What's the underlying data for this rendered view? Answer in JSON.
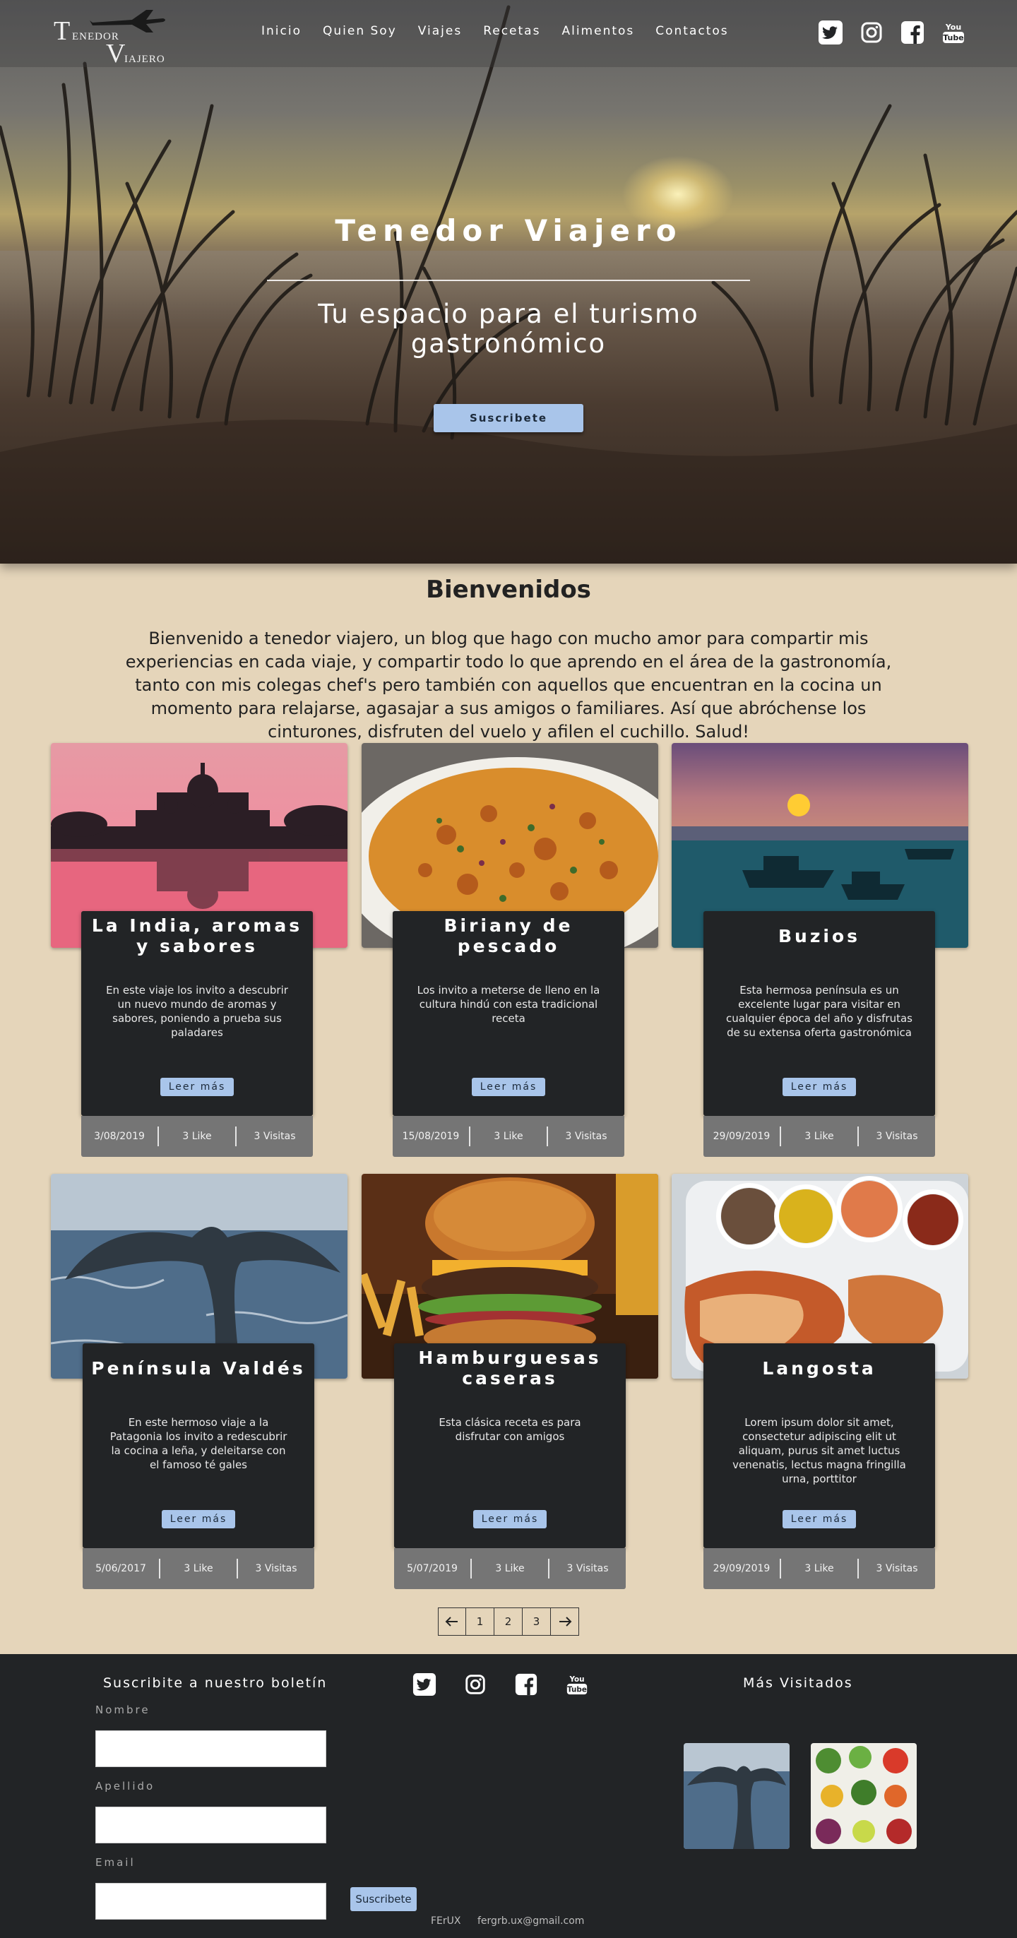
{
  "logo": {
    "t_big": "T",
    "t_small": "ENEDOR",
    "v_big": "V",
    "v_small": "IAJERO"
  },
  "nav": {
    "items": [
      "Inicio",
      "Quien Soy",
      "Viajes",
      "Recetas",
      "Alimentos",
      "Contactos"
    ]
  },
  "social_icons": [
    "twitter-icon",
    "instagram-icon",
    "facebook-icon",
    "youtube-icon"
  ],
  "hero": {
    "title": "Tenedor Viajero",
    "subtitle": "Tu espacio para el turismo gastronómico",
    "subscribe_label": "Suscribete"
  },
  "welcome": {
    "title": "Bienvenidos",
    "text": "Bienvenido a tenedor viajero, un blog que hago con mucho amor para compartir mis experiencias en cada viaje, y compartir todo lo que aprendo en el área de la gastronomía, tanto con mis colegas chef's pero también con aquellos que encuentran en la cocina un momento para relajarse, agasajar a sus amigos o familiares. Así que abróchense los cinturones, disfruten del vuelo y afilen el cuchillo. Salud!"
  },
  "cards": [
    {
      "title": "La India, aromas y sabores",
      "desc": "En este viaje los invito a descubrir un nuevo mundo de aromas y sabores, poniendo a prueba sus paladares",
      "button": "Leer más",
      "date": "3/08/2019",
      "likes": "3 Like",
      "visits": "3 Visitas"
    },
    {
      "title": "Biriany de pescado",
      "desc": "Los invito a meterse de lleno en la cultura hindú con esta tradicional receta",
      "button": "Leer más",
      "date": "15/08/2019",
      "likes": "3 Like",
      "visits": "3 Visitas"
    },
    {
      "title": "Buzios",
      "desc": "Esta hermosa península es un excelente lugar para visitar en cualquier época del año y disfrutas de su extensa oferta gastronómica",
      "button": "Leer más",
      "date": "29/09/2019",
      "likes": "3 Like",
      "visits": "3 Visitas"
    },
    {
      "title": "Península Valdés",
      "desc": "En este hermoso viaje a la Patagonia los invito a redescubrir la cocina a leña, y deleitarse con el famoso té gales",
      "button": "Leer más",
      "date": "5/06/2017",
      "likes": "3 Like",
      "visits": "3 Visitas"
    },
    {
      "title": "Hamburguesas caseras",
      "desc": "Esta clásica receta es para disfrutar con amigos",
      "button": "Leer más",
      "date": "5/07/2019",
      "likes": "3 Like",
      "visits": "3 Visitas"
    },
    {
      "title": "Langosta",
      "desc": "Lorem ipsum dolor sit amet, consectetur adipiscing elit ut aliquam, purus sit amet luctus venenatis, lectus magna fringilla urna, porttitor",
      "button": "Leer más",
      "date": "29/09/2019",
      "likes": "3 Like",
      "visits": "3 Visitas"
    }
  ],
  "pagination": {
    "prev_icon": "arrow-left-icon",
    "pages": [
      "1",
      "2",
      "3"
    ],
    "next_icon": "arrow-right-icon"
  },
  "footer": {
    "newsletter_title": "Suscribite a nuestro boletín",
    "name_label": "Nombre",
    "surname_label": "Apellido",
    "email_label": "Email",
    "subscribe_button": "Suscribete",
    "most_visited_title": "Más Visitados",
    "credit": "FErUX",
    "email": "fergrb.ux@gmail.com"
  },
  "colors": {
    "page_bg": "#e5d5ba",
    "dark": "#222426",
    "button_blue": "#a9c5ea",
    "card_footer": "#757575"
  }
}
